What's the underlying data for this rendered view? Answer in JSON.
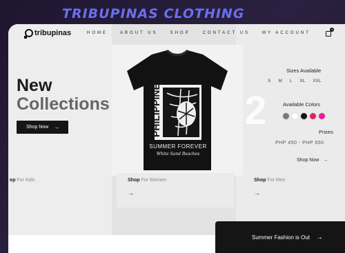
{
  "banner": {
    "title": "TRIBUPINAS CLOTHING"
  },
  "header": {
    "logo": "tribupinas",
    "menu": [
      "HOME",
      "ABOUT US",
      "SHOP",
      "CONTACT US",
      "MY ACCOUNT"
    ],
    "cart_count": "0"
  },
  "hero": {
    "line1": "New",
    "line2": "Collections",
    "shop_now": "Shop Now",
    "ghost_number": "02"
  },
  "shirt": {
    "text_vertical": "PHILIPPINES",
    "text_line1": "SUMMER FOREVER",
    "text_line2": "White Sand Beaches"
  },
  "details": {
    "sizes_label": "Sizes Available",
    "sizes": [
      "S",
      "M",
      "L",
      "XL",
      "XXL"
    ],
    "colors_label": "Available Colors",
    "colors": [
      "#7a7a7a",
      "#ffffff",
      "#111111",
      "#e0245e",
      "#e61e9a"
    ],
    "prizes_label": "Prizes",
    "price": "PHP 450 - PHP 650",
    "shop_now": "Shop Now"
  },
  "categories": [
    {
      "prefix": "op",
      "suffix": "For Kids"
    },
    {
      "prefix": "Shop",
      "suffix": "For Women"
    },
    {
      "prefix": "Shop",
      "suffix": "For Men"
    }
  ],
  "cta": {
    "label": "Summer Fashion is Out"
  }
}
